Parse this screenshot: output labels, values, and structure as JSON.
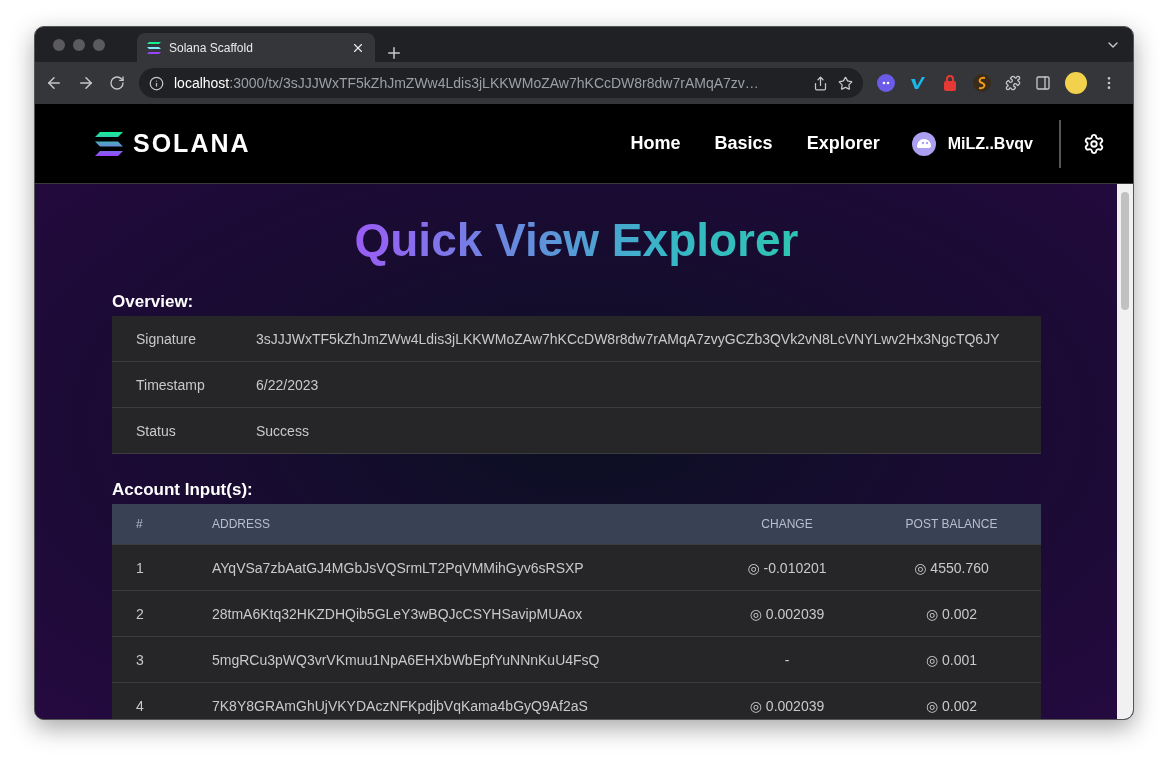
{
  "browser": {
    "tab": {
      "title": "Solana Scaffold",
      "selected": true
    },
    "url_host": "localhost",
    "url_path": ":3000/tx/3sJJJWxTF5kZhJmZWw4Ldis3jLKKWMoZAw7hKCcDW8r8dw7rAMqA7zv…"
  },
  "nav": {
    "logo": "SOLANA",
    "links": [
      "Home",
      "Basics",
      "Explorer"
    ],
    "wallet": "MiLZ..Bvqv"
  },
  "title": "Quick View Explorer",
  "overview": {
    "heading": "Overview:",
    "rows": [
      {
        "label": "Signature",
        "value": "3sJJJWxTF5kZhJmZWw4Ldis3jLKKWMoZAw7hKCcDW8r8dw7rAMqA7zvyGCZb3QVk2vN8LcVNYLwv2Hx3NgcTQ6JY"
      },
      {
        "label": "Timestamp",
        "value": "6/22/2023"
      },
      {
        "label": "Status",
        "value": "Success"
      }
    ]
  },
  "accounts": {
    "heading": "Account Input(s):",
    "columns": [
      "#",
      "ADDRESS",
      "CHANGE",
      "POST BALANCE"
    ],
    "rows": [
      [
        "1",
        "AYqVSa7zbAatGJ4MGbJsVQSrmLT2PqVMMihGyv6sRSXP",
        "◎ -0.010201",
        "◎ 4550.760"
      ],
      [
        "2",
        "28tmA6Ktq32HKZDHQib5GLeY3wBQJcCSYHSavipMUAox",
        "◎ 0.002039",
        "◎ 0.002"
      ],
      [
        "3",
        "5mgRCu3pWQ3vrVKmuu1NpA6EHXbWbEpfYuNNnKuU4FsQ",
        "-",
        "◎ 0.001"
      ],
      [
        "4",
        "7K8Y8GRAmGhUjVKYDAczNFKpdjbVqKama4bGyQ9Af2aS",
        "◎ 0.002039",
        "◎ 0.002"
      ]
    ]
  }
}
